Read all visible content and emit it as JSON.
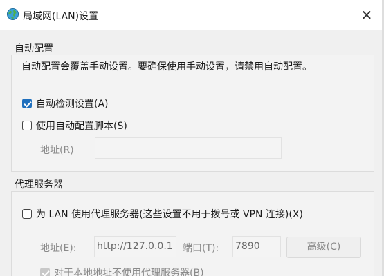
{
  "window": {
    "title": "局域网(LAN)设置",
    "close_glyph": "✕",
    "icon": "globe-network-icon"
  },
  "auto_config": {
    "group_title": "自动配置",
    "description": "自动配置会覆盖手动设置。要确保使用手动设置，请禁用自动配置。",
    "auto_detect": {
      "label": "自动检测设置(A)",
      "checked": true
    },
    "use_script": {
      "label": "使用自动配置脚本(S)",
      "checked": false
    },
    "address_label": "地址(R)",
    "address_value": ""
  },
  "proxy": {
    "group_title": "代理服务器",
    "use_proxy": {
      "label": "为 LAN 使用代理服务器(这些设置不用于拨号或 VPN 连接)(X)",
      "checked": false
    },
    "address_label": "地址(E):",
    "address_value": "http://127.0.0.1",
    "port_label": "端口(T):",
    "port_value": "7890",
    "advanced_label": "高级(C)",
    "bypass_local": {
      "label": "对于本地地址不使用代理服务器(B)",
      "checked": true
    }
  },
  "colors": {
    "accent": "#1f6fbd",
    "dialog_bg": "#f0f0f0",
    "disabled_text": "#8a8a8a"
  }
}
